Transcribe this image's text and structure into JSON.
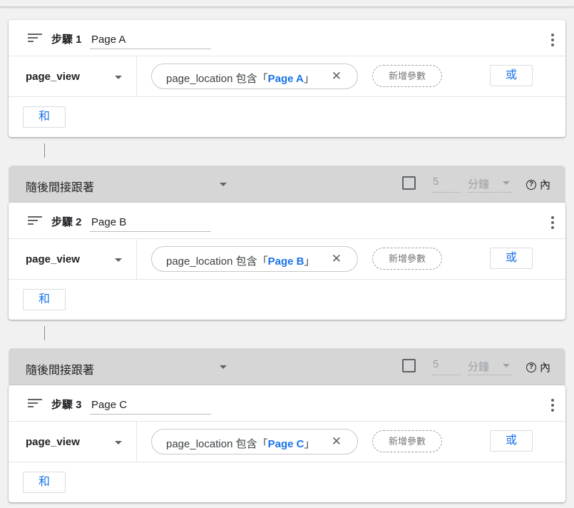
{
  "steps": [
    {
      "label": "步驟 1",
      "name": "Page A",
      "event": "page_view",
      "param_prefix": "page_location 包含「",
      "param_value": "Page A",
      "param_suffix": "」",
      "close_glyph": "✕",
      "add_param_label": "新增參數",
      "or_label": "或",
      "and_label": "和"
    },
    {
      "label": "步驟 2",
      "name": "Page B",
      "event": "page_view",
      "param_prefix": "page_location 包含「",
      "param_value": "Page B",
      "param_suffix": "」",
      "close_glyph": "✕",
      "add_param_label": "新增參數",
      "or_label": "或",
      "and_label": "和"
    },
    {
      "label": "步驟 3",
      "name": "Page C",
      "event": "page_view",
      "param_prefix": "page_location 包含「",
      "param_value": "Page C",
      "param_suffix": "」",
      "close_glyph": "✕",
      "add_param_label": "新增參數",
      "or_label": "或",
      "and_label": "和"
    }
  ],
  "sequence_bars": [
    {
      "label": "隨後間接跟著",
      "checkbox_checked": false,
      "number": "5",
      "unit": "分鐘",
      "help_glyph": "?",
      "within_label": "內"
    },
    {
      "label": "隨後間接跟著",
      "checkbox_checked": false,
      "number": "5",
      "unit": "分鐘",
      "help_glyph": "?",
      "within_label": "內"
    }
  ],
  "icons": {
    "sort": "sort-icon",
    "menu": "more-vert-icon",
    "dropdown": "arrow-drop-down-icon",
    "close": "close-icon",
    "help": "help-icon"
  },
  "colors": {
    "accent": "#1a73e8",
    "card_bg": "#ffffff",
    "page_bg": "#f1f1f1",
    "sequence_bar_bg": "#d6d6d6"
  }
}
